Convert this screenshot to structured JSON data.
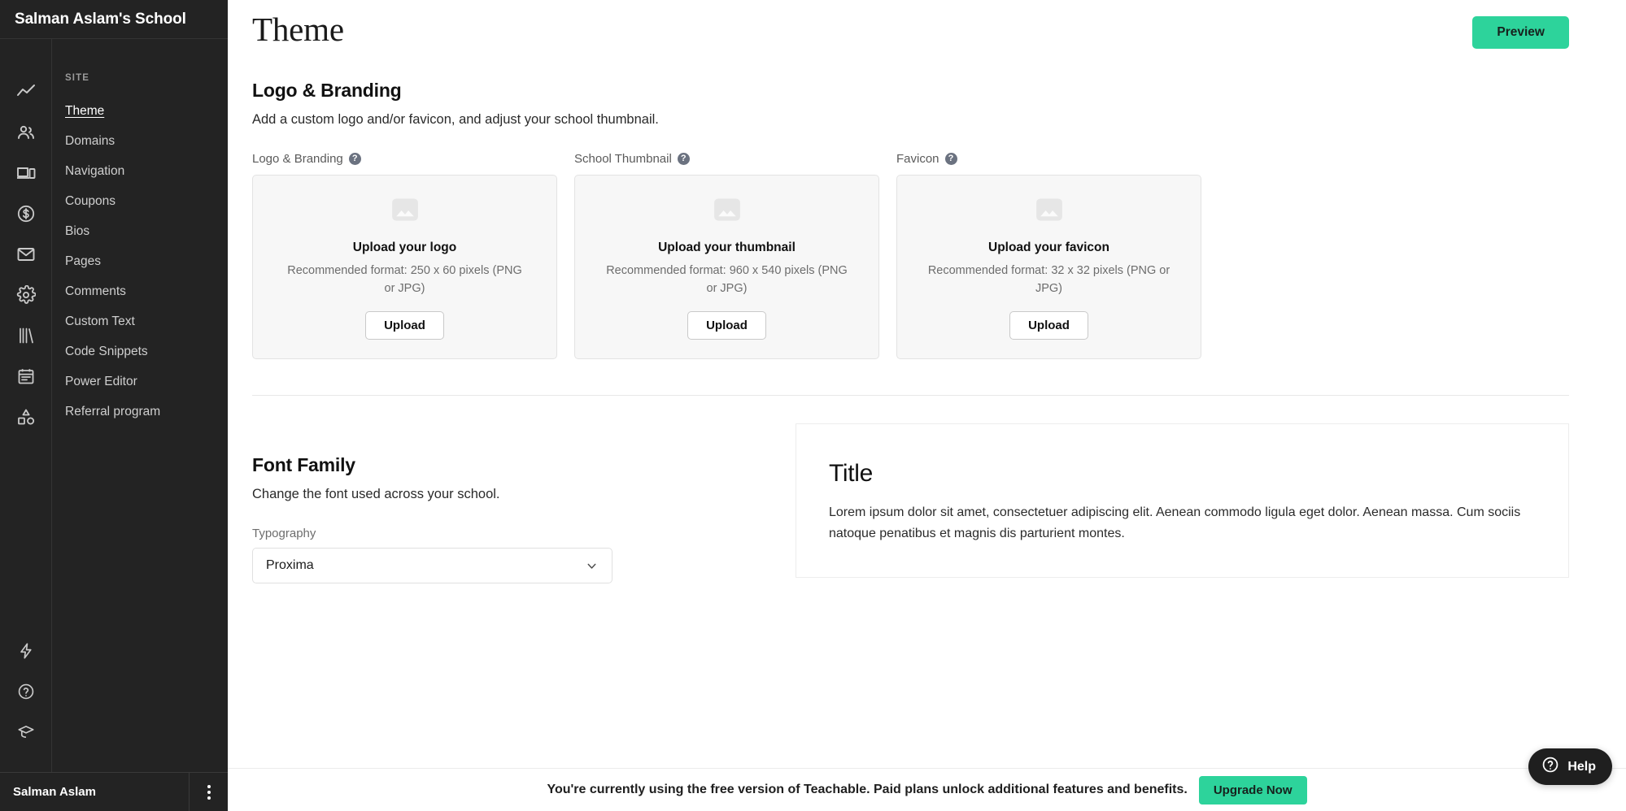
{
  "sidebar": {
    "school_title": "Salman Aslam's School",
    "rail_icons": [
      {
        "name": "analytics-icon"
      },
      {
        "name": "users-icon"
      },
      {
        "name": "devices-icon"
      },
      {
        "name": "sales-dollar-icon"
      },
      {
        "name": "email-icon"
      },
      {
        "name": "gear-icon"
      },
      {
        "name": "library-books-icon"
      },
      {
        "name": "calendar-icon"
      },
      {
        "name": "shapes-icon"
      }
    ],
    "rail_bottom_icons": [
      {
        "name": "lightning-icon"
      },
      {
        "name": "help-circle-icon"
      },
      {
        "name": "graduation-cap-icon"
      }
    ],
    "section_label": "SITE",
    "items": [
      {
        "label": "Theme",
        "active": true
      },
      {
        "label": "Domains",
        "active": false
      },
      {
        "label": "Navigation",
        "active": false
      },
      {
        "label": "Coupons",
        "active": false
      },
      {
        "label": "Bios",
        "active": false
      },
      {
        "label": "Pages",
        "active": false
      },
      {
        "label": "Comments",
        "active": false
      },
      {
        "label": "Custom Text",
        "active": false
      },
      {
        "label": "Code Snippets",
        "active": false
      },
      {
        "label": "Power Editor",
        "active": false
      },
      {
        "label": "Referral program",
        "active": false
      }
    ],
    "user_name": "Salman Aslam"
  },
  "header": {
    "title": "Theme",
    "preview_label": "Preview"
  },
  "logo_branding": {
    "heading": "Logo & Branding",
    "subtitle": "Add a custom logo and/or favicon, and adjust your school thumbnail.",
    "cards": [
      {
        "label": "Logo & Branding",
        "heading": "Upload your logo",
        "description": "Recommended format: 250 x 60 pixels (PNG or JPG)",
        "button": "Upload"
      },
      {
        "label": "School Thumbnail",
        "heading": "Upload your thumbnail",
        "description": "Recommended format: 960 x 540 pixels (PNG or JPG)",
        "button": "Upload"
      },
      {
        "label": "Favicon",
        "heading": "Upload your favicon",
        "description": "Recommended format: 32 x 32 pixels (PNG or JPG)",
        "button": "Upload"
      }
    ]
  },
  "font_family": {
    "heading": "Font Family",
    "subtitle": "Change the font used across your school.",
    "typography_label": "Typography",
    "selected_font": "Proxima",
    "preview": {
      "title": "Title",
      "body": "Lorem ipsum dolor sit amet, consectetuer adipiscing elit. Aenean commodo ligula eget dolor. Aenean massa. Cum sociis natoque penatibus et magnis dis parturient montes."
    }
  },
  "bottom_banner": {
    "text": "You're currently using the free version of Teachable. Paid plans unlock additional features and benefits.",
    "button": "Upgrade Now"
  },
  "help_widget": {
    "label": "Help"
  },
  "colors": {
    "sidebar_bg": "#232323",
    "accent_green": "#2dd39b",
    "card_bg": "#f7f7f7",
    "help_bg": "#1f1f1f"
  }
}
